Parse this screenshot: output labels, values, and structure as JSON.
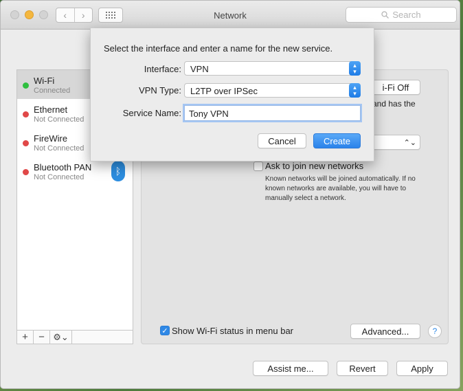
{
  "window": {
    "title": "Network"
  },
  "search": {
    "placeholder": "Search",
    "icon": "search-icon"
  },
  "services": [
    {
      "name": "Wi-Fi",
      "status": "Connected",
      "color": "#2fbf3f"
    },
    {
      "name": "Ethernet",
      "status": "Not Connected",
      "color": "#e04848"
    },
    {
      "name": "FireWire",
      "status": "Not Connected",
      "color": "#e04848"
    },
    {
      "name": "Bluetooth PAN",
      "status": "Not Connected",
      "color": "#e04848"
    }
  ],
  "sidebar_tools": {
    "add": "+",
    "remove": "−",
    "gear": "⚙⌄"
  },
  "pane": {
    "wifi_off_button": "i-Fi Off",
    "text_fragment": "and has the",
    "ask_join_label": "Ask to join new networks",
    "ask_join_description": "Known networks will be joined automatically. If no known networks are available, you will have to manually select a network.",
    "show_status_label": "Show Wi-Fi status in menu bar",
    "show_status_checked": true,
    "advanced_button": "Advanced...",
    "help": "?"
  },
  "bottom": {
    "assist": "Assist me...",
    "revert": "Revert",
    "apply": "Apply"
  },
  "sheet": {
    "title": "Select the interface and enter a name for the new service.",
    "interface_label": "Interface:",
    "interface_value": "VPN",
    "vpn_type_label": "VPN Type:",
    "vpn_type_value": "L2TP over IPSec",
    "service_name_label": "Service Name:",
    "service_name_value": "Tony VPN",
    "cancel": "Cancel",
    "create": "Create"
  },
  "colors": {
    "accent": "#2a82ea",
    "bluetooth": "#2d8ee0"
  }
}
